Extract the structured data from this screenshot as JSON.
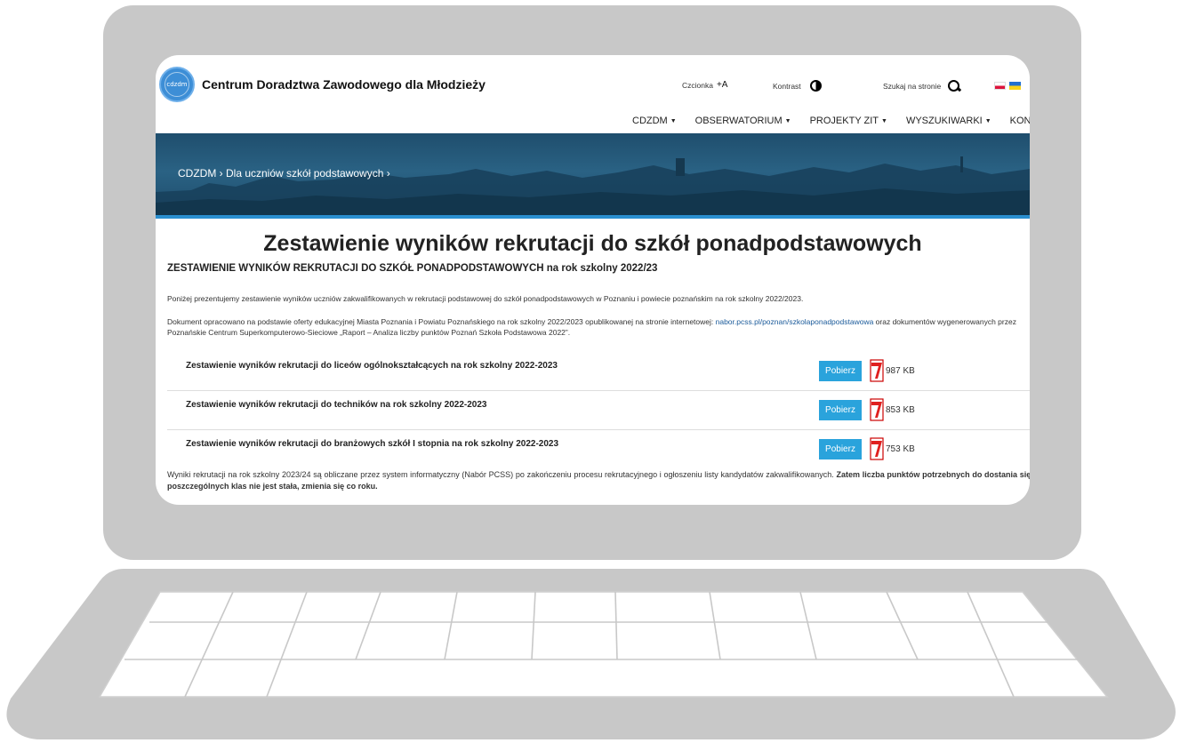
{
  "header": {
    "logo_text": "cdzdm",
    "site_title": "Centrum Doradztwa Zawodowego dla Młodzieży",
    "font_label": "Czcionka",
    "font_action": "+A",
    "contrast_label": "Kontrast",
    "search_label": "Szukaj na stronie"
  },
  "nav": {
    "items": [
      {
        "label": "CDZDM"
      },
      {
        "label": "OBSERWATORIUM"
      },
      {
        "label": "PROJEKTY ZIT"
      },
      {
        "label": "WYSZUKIWARKI"
      },
      {
        "label": "KONTAKT"
      }
    ]
  },
  "breadcrumb": "CDZDM › Dla uczniów szkół podstawowych ›",
  "main": {
    "title": "Zestawienie wyników rekrutacji do szkół ponadpodstawowych",
    "subtitle": "ZESTAWIENIE WYNIKÓW REKRUTACJI DO SZKÓŁ PONADPODSTAWOWYCH na rok szkolny 2022/23",
    "intro": "Poniżej prezentujemy zestawienie wyników uczniów zakwalifikowanych w rekrutacji podstawowej do szkół ponadpodstawowych w Poznaniu i powiecie poznańskim na rok szkolny 2022/2023.",
    "source_before": "Dokument opracowano na podstawie oferty edukacyjnej Miasta Poznania i Powiatu Poznańskiego na rok szkolny 2022/2023 opublikowanej na stronie internetowej: ",
    "source_link": "nabor.pcss.pl/poznan/szkolaponadpodstawowa",
    "source_after": " oraz dokumentów wygenerowanych przez Poznańskie Centrum Superkomputerowo-Sieciowe „Raport – Analiza liczby punktów Poznań Szkoła Podstawowa 2022”.",
    "documents": [
      {
        "title": "Zestawienie wyników rekrutacji do liceów ogólnokształcących na rok szkolny 2022-2023",
        "button": "Pobierz",
        "size": "987 KB"
      },
      {
        "title": "Zestawienie wyników rekrutacji do techników na rok szkolny 2022-2023",
        "button": "Pobierz",
        "size": "853 KB"
      },
      {
        "title": "Zestawienie wyników rekrutacji do branżowych szkół I stopnia na rok szkolny 2022-2023",
        "button": "Pobierz",
        "size": "753 KB"
      }
    ],
    "note_regular": "Wyniki rekrutacji na rok szkolny 2023/24 są obliczane przez system informatyczny (Nabór PCSS) po zakończeniu procesu rekrutacyjnego i ogłoszeniu listy kandydatów zakwalifikowanych. ",
    "note_bold": "Zatem liczba punktów potrzebnych do dostania się do poszczególnych klas nie jest stała, zmienia się co roku."
  },
  "colors": {
    "accent": "#2aa3dc",
    "hero": "#1f4e6d",
    "laptop": "#c8c8c8"
  }
}
